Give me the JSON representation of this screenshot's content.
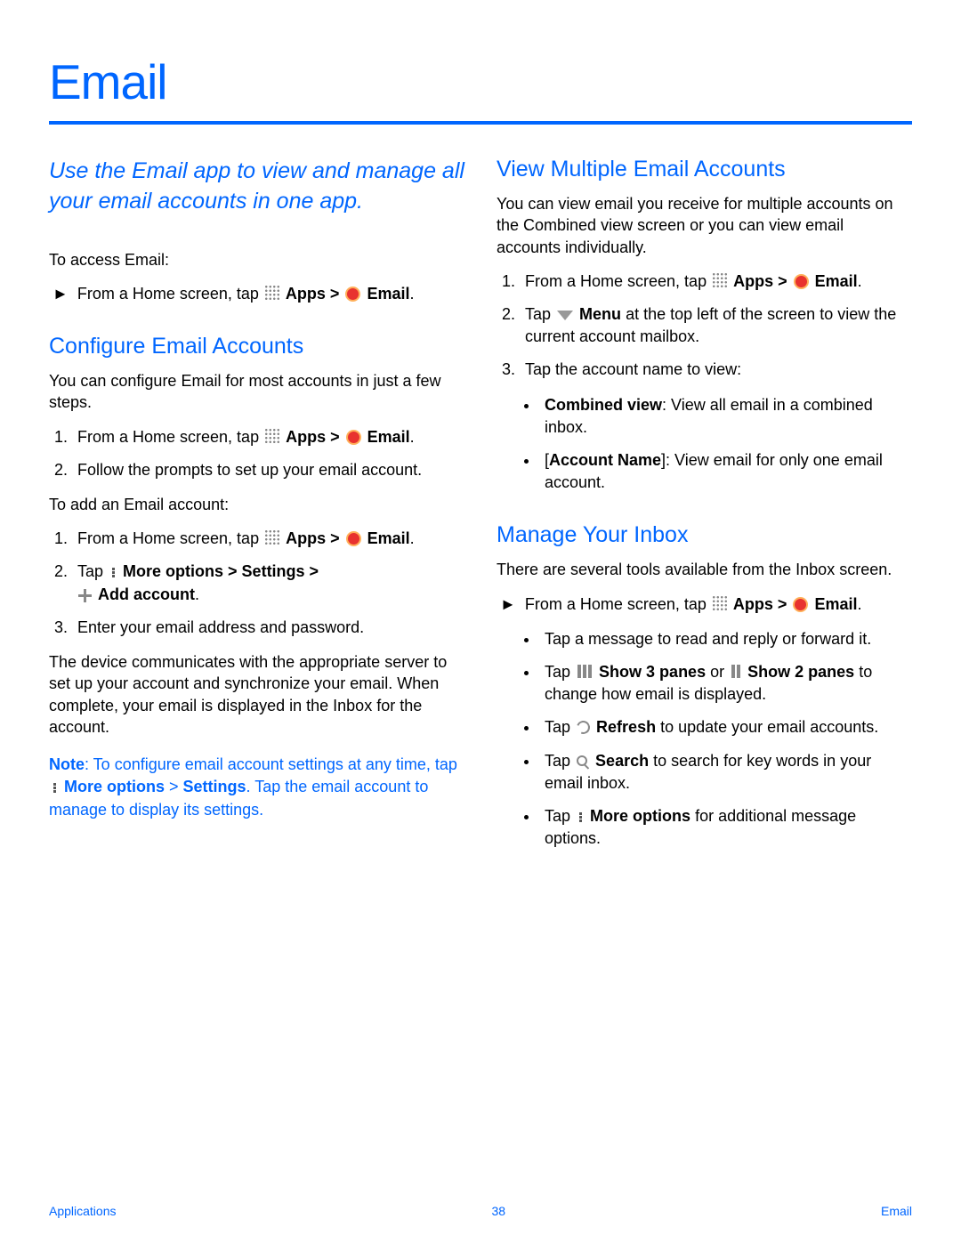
{
  "title": "Email",
  "intro": "Use the Email app to view and manage all your email accounts in one app.",
  "left": {
    "access_label": "To access Email:",
    "access_step_a": "From a Home screen, tap ",
    "access_step_b": "Apps > ",
    "access_step_c": "Email",
    "configure_title": "Configure Email Accounts",
    "configure_intro": "You can configure Email for most accounts in just a few steps.",
    "cfg_s1a": "From a Home screen, tap ",
    "cfg_s1b": "Apps > ",
    "cfg_s1c": "Email",
    "cfg_s2": "Follow the prompts to set up your email account.",
    "add_intro": "To add an Email account:",
    "add_s1a": "From a Home screen, tap ",
    "add_s1b": "Apps > ",
    "add_s1c": "Email",
    "add_s2a": "Tap ",
    "add_s2b": "More options > Settings > ",
    "add_s2c": "Add account",
    "add_s3": "Enter your email address and password.",
    "add_outro": "The device communicates with the appropriate server to set up your account and synchronize your email. When complete, your email is displayed in the Inbox for the account.",
    "note_a": "Note",
    "note_b": ": To configure email account settings at any time, tap ",
    "note_c": "More options",
    "note_d": " > ",
    "note_e": "Settings",
    "note_f": ". Tap the email account to manage to display its settings."
  },
  "right": {
    "view_title": "View Multiple Email Accounts",
    "view_intro": "You can view email you receive for multiple accounts on the Combined view screen or you can view email accounts individually.",
    "v_s1a": "From a Home screen, tap ",
    "v_s1b": "Apps > ",
    "v_s1c": "Email",
    "v_s2a": "Tap ",
    "v_s2b": "Menu",
    "v_s2c": " at the top left of the screen to view the current account mailbox.",
    "v_s3": "Tap the account name to view:",
    "v_cv_a": "Combined view",
    "v_cv_b": ": View all email in a combined inbox.",
    "v_an_a": "[",
    "v_an_b": "Account Name",
    "v_an_c": "]: View email for only one email account.",
    "man_title": "Manage Your Inbox",
    "man_intro": "There are several tools available from the Inbox screen.",
    "m_s1a": "From a Home screen, tap ",
    "m_s1b": "Apps > ",
    "m_s1c": "Email",
    "m_b1": "Tap a message to read and reply or forward it.",
    "m_b2a": "Tap ",
    "m_b2b": "Show 3 panes",
    "m_b2c": " or ",
    "m_b2d": "Show 2 panes",
    "m_b2e": " to change how email is displayed.",
    "m_b3a": "Tap ",
    "m_b3b": "Refresh",
    "m_b3c": " to update your email accounts.",
    "m_b4a": "Tap ",
    "m_b4b": "Search",
    "m_b4c": " to search for key words in your email inbox.",
    "m_b5a": "Tap ",
    "m_b5b": "More options",
    "m_b5c": " for additional message options."
  },
  "footer": {
    "left": "Applications",
    "center": "38",
    "right": "Email"
  }
}
